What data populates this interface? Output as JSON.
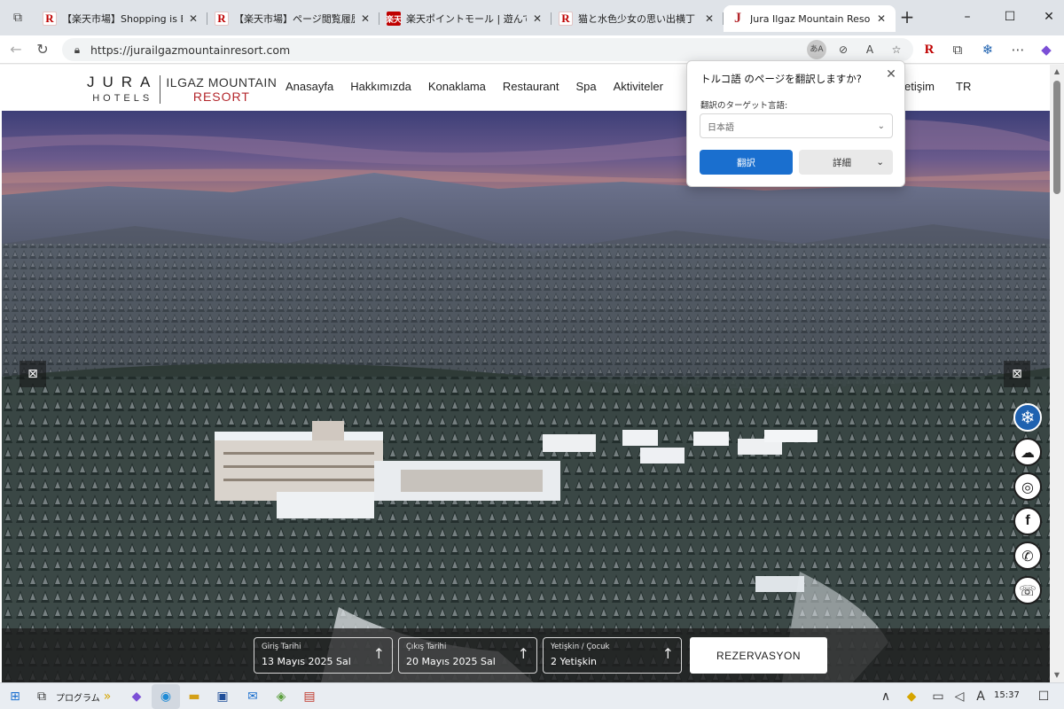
{
  "browser": {
    "tabs": [
      {
        "favicon": "R",
        "favicon_kind": "rakuten",
        "title": "【楽天市場】Shopping is Entertainment",
        "active": false
      },
      {
        "favicon": "R",
        "favicon_kind": "rakuten",
        "title": "【楽天市場】ページ閲覧履歴",
        "active": false
      },
      {
        "favicon": "楽天",
        "favicon_kind": "rakuten-point",
        "title": "楽天ポイントモール | 遊んで、買っ",
        "active": false
      },
      {
        "favicon": "R",
        "favicon_kind": "rakuten",
        "title": "猫と水色少女の思い出横丁 | 人",
        "active": false
      },
      {
        "favicon": "J",
        "favicon_kind": "jura",
        "title": "Jura Ilgaz Mountain Resort Ho",
        "active": true
      }
    ],
    "tab_close_glyph": "✕",
    "new_tab_glyph": "+",
    "window_controls": {
      "minimize": "–",
      "maximize": "☐",
      "close": "✕"
    },
    "url": "https://jurailgazmountainresort.com",
    "lang_badge": "あA"
  },
  "site": {
    "logo": {
      "jura_top": "JURA",
      "jura_bottom": "HOTELS",
      "resort_top": "ILGAZ MOUNTAIN",
      "resort_bottom": "RESORT"
    },
    "nav": [
      "Anasayfa",
      "Hakkımızda",
      "Konaklama",
      "Restaurant",
      "Spa",
      "Aktiviteler"
    ],
    "nav_contact_partial": "etişim",
    "nav_lang": "TR",
    "slider_prev": "⊠",
    "slider_next": "⊠",
    "booking": {
      "checkin_label": "Giriş Tarihi",
      "checkin_value": "13 Mayıs 2025 Sal",
      "checkout_label": "Çıkış Tarihi",
      "checkout_value": "20 Mayıs 2025 Sal",
      "guests_label": "Yetişkin / Çocuk",
      "guests_value": "2 Yetişkin",
      "arrow": "↑",
      "reserve_label": "REZERVASYON"
    }
  },
  "translate_popup": {
    "title": "トルコ語 のページを翻訳しますか?",
    "target_label": "翻訳のターゲット言語:",
    "selected_language": "日本語",
    "translate_button": "翻訳",
    "details_button": "詳細",
    "chevron": "⌄"
  },
  "taskbar": {
    "programs_label": "プログラム",
    "time": "15:37",
    "ime_indicator": "A"
  },
  "colors": {
    "brand_red": "#b3262b",
    "translate_blue": "#1a6fcf",
    "snow_badge": "#1f62b0"
  }
}
